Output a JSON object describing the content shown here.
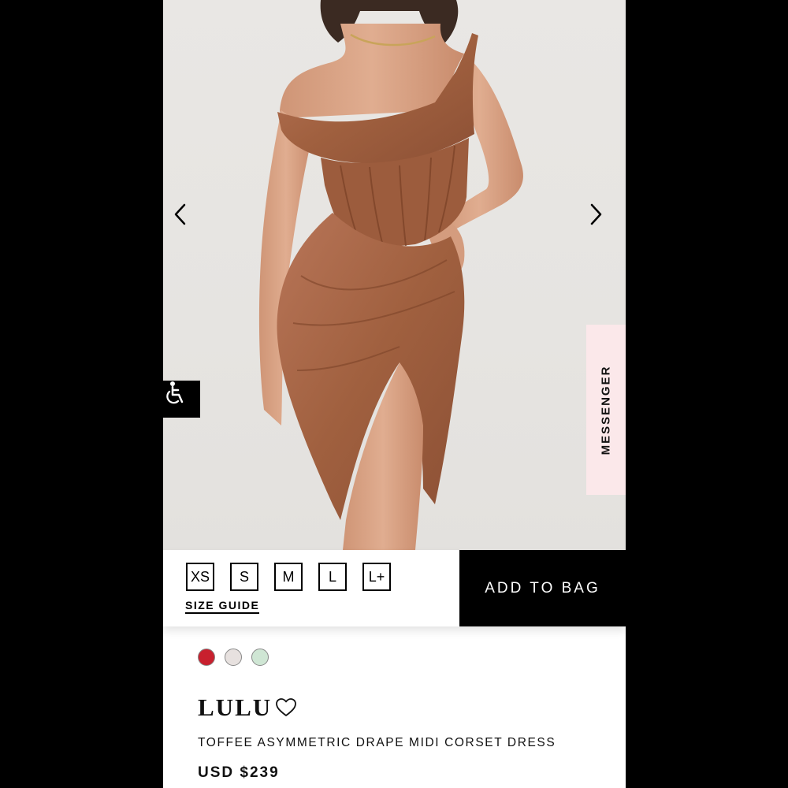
{
  "carousel": {
    "prev_icon": "chevron-left-icon",
    "next_icon": "chevron-right-icon"
  },
  "accessibility": {
    "icon": "wheelchair-accessibility-icon"
  },
  "messenger": {
    "label": "MESSENGER",
    "background": "#fbe8ea"
  },
  "sizes": [
    "XS",
    "S",
    "M",
    "L",
    "L+"
  ],
  "size_guide_label": "SIZE GUIDE",
  "add_to_bag_label": "ADD TO BAG",
  "swatches": [
    {
      "color": "#c8202e"
    },
    {
      "color": "#e7e1df"
    },
    {
      "color": "#cfe6d4"
    }
  ],
  "product": {
    "name": "LULU",
    "subtitle": "TOFFEE ASYMMETRIC DRAPE MIDI CORSET DRESS",
    "price": "USD $239",
    "wishlist_icon": "heart-outline-icon"
  },
  "colors": {
    "dress": "#a5654a",
    "skin": "#d9a486",
    "accent": "#000000"
  }
}
